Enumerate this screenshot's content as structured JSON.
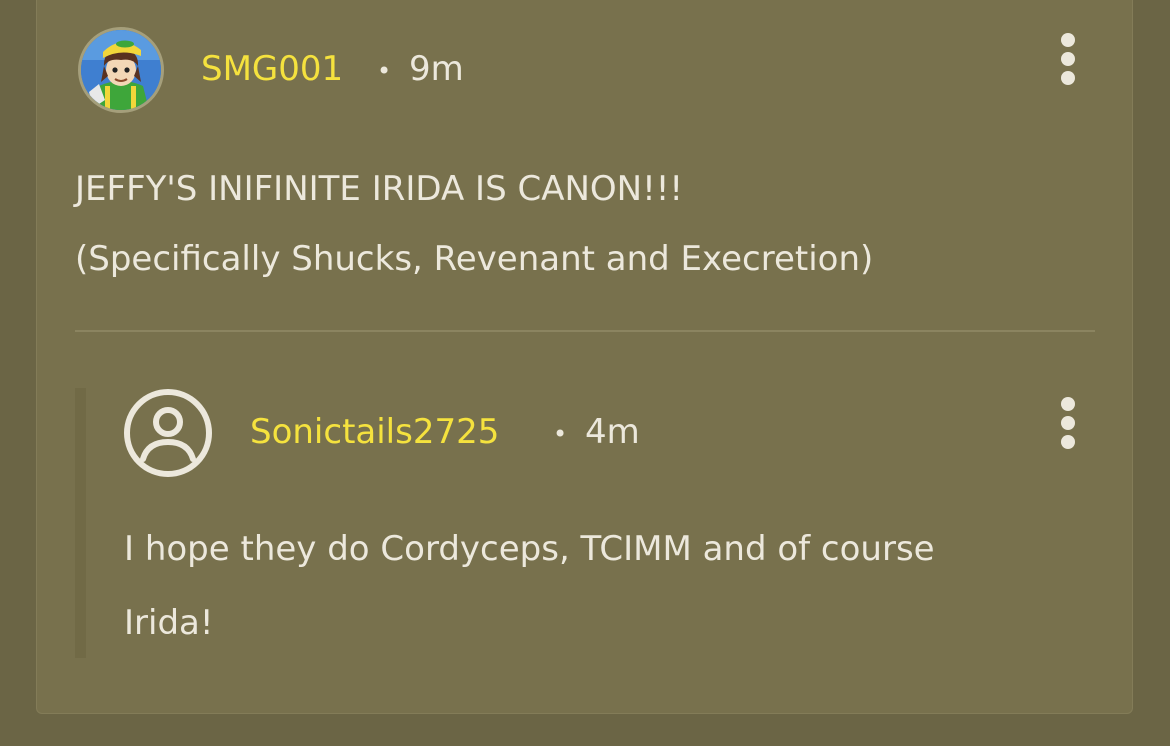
{
  "comment": {
    "username": "SMG001",
    "separator": "•",
    "time": "9m",
    "avatar_icon": "cartoon-character-avatar",
    "text_lines": [
      "JEFFY'S INIFINITE IRIDA IS CANON!!!",
      "(Specifically Shucks, Revenant and Execretion)"
    ],
    "menu_icon": "more-vertical-icon"
  },
  "reply": {
    "username": "Sonictails2725",
    "separator": "•",
    "time": "4m",
    "avatar_icon": "default-user-icon",
    "text_lines": [
      "I hope they do Cordyceps, TCIMM and of course",
      "Irida!"
    ],
    "menu_icon": "more-vertical-icon"
  },
  "colors": {
    "background": "#6b6545",
    "card": "#78714d",
    "username": "#f5e23e",
    "text": "#ece8dc"
  }
}
